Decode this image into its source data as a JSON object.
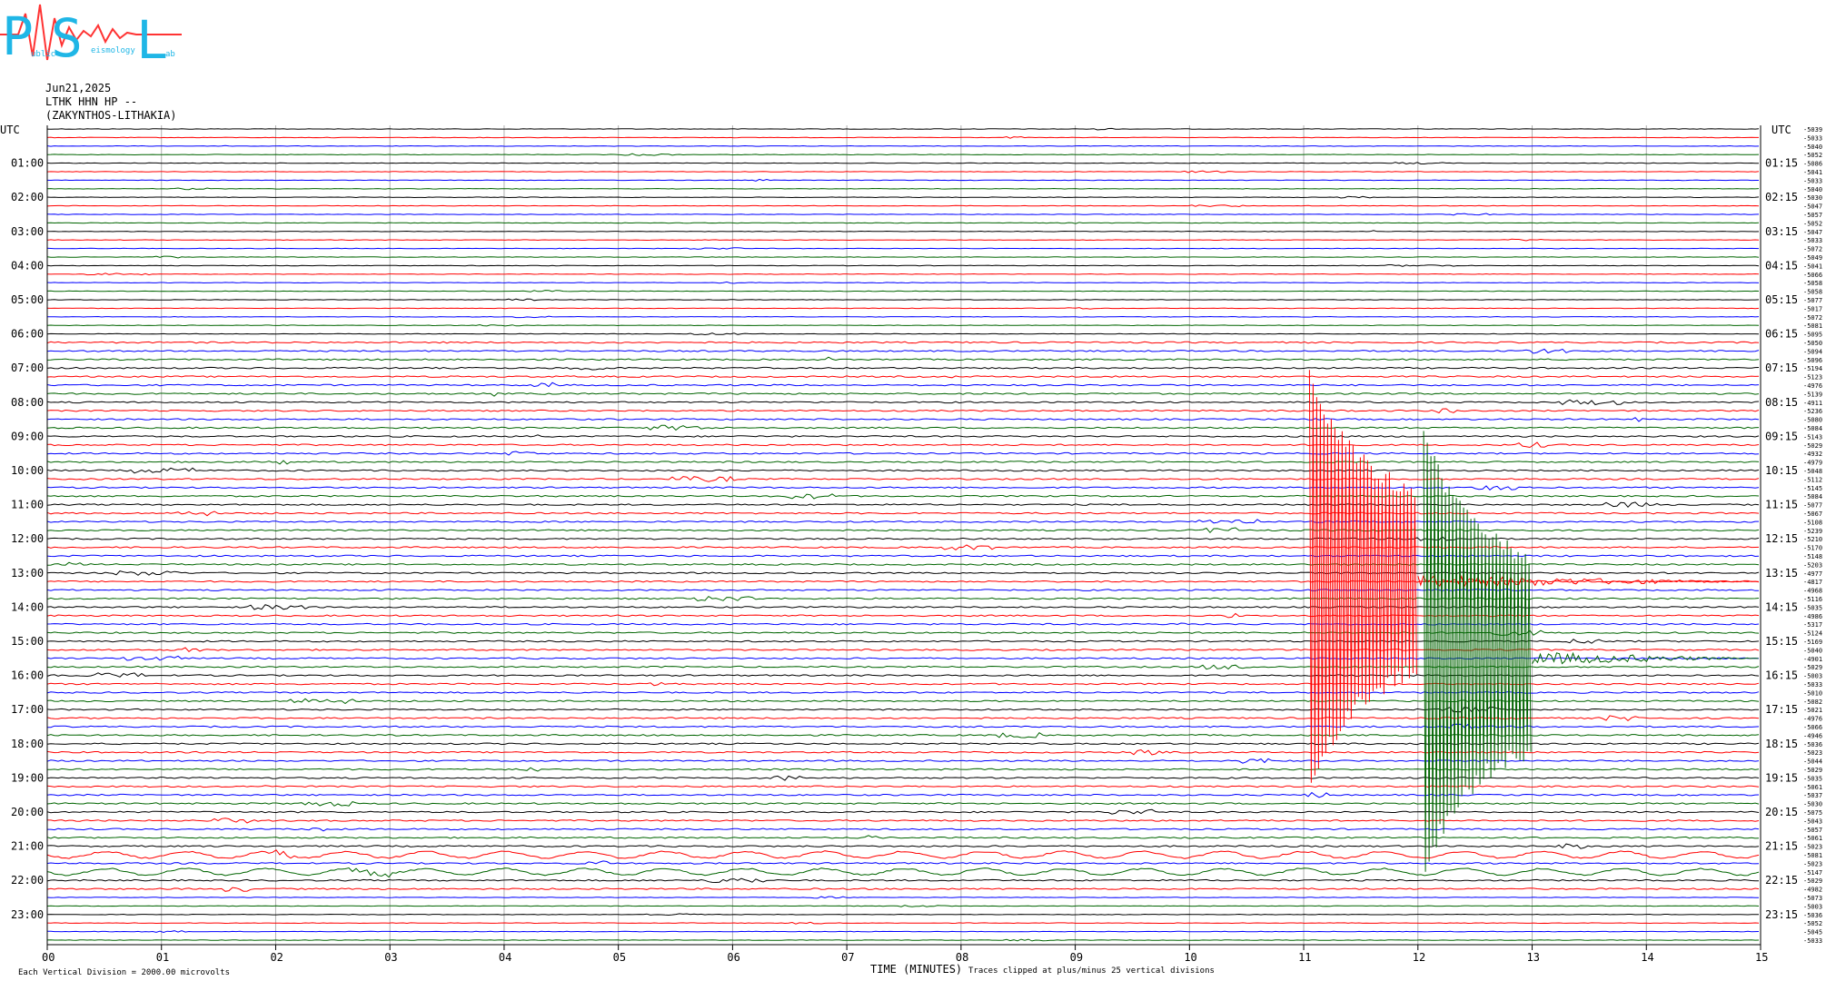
{
  "logo": {
    "letters": [
      "P",
      "S",
      "L"
    ],
    "small_words": [
      "ublic",
      "eismology",
      "ab"
    ]
  },
  "header": {
    "date": "Jun21,2025",
    "station": "LTHK HHN HP --",
    "location": "(ZAKYNTHOS-LITHAKIA)"
  },
  "footer": {
    "scale_note": "Each Vertical Division = 2000.00 microvolts",
    "axis_title": "TIME (MINUTES)",
    "clip_note": "Traces clipped at plus/minus 25 vertical divisions"
  },
  "chart_data": {
    "type": "line",
    "title": "",
    "xlabel": "TIME (MINUTES)",
    "xlim": [
      0,
      15
    ],
    "x_ticks": [
      "00",
      "01",
      "02",
      "03",
      "04",
      "05",
      "06",
      "07",
      "08",
      "09",
      "10",
      "11",
      "12",
      "13",
      "14",
      "15"
    ],
    "left_axis_top_label": "UTC",
    "right_axis_top_label": "UTC",
    "left_hour_labels": [
      "01:00",
      "02:00",
      "03:00",
      "04:00",
      "05:00",
      "06:00",
      "07:00",
      "08:00",
      "09:00",
      "10:00",
      "11:00",
      "12:00",
      "13:00",
      "14:00",
      "15:00",
      "16:00",
      "17:00",
      "18:00",
      "19:00",
      "20:00",
      "21:00",
      "22:00",
      "23:00"
    ],
    "right_hour_labels": [
      "01:15",
      "02:15",
      "03:15",
      "04:15",
      "05:15",
      "06:15",
      "07:15",
      "08:15",
      "09:15",
      "10:15",
      "11:15",
      "12:15",
      "13:15",
      "14:15",
      "15:15",
      "16:15",
      "17:15",
      "18:15",
      "19:15",
      "20:15",
      "21:15",
      "22:15",
      "23:15"
    ],
    "row_minutes": 15,
    "row_count": 96,
    "trace_colors": [
      "#000000",
      "#ff0000",
      "#0000ff",
      "#006400"
    ],
    "clip_divisions": 25,
    "microvolts_per_division": 2000,
    "row_offsets": [
      "-5039",
      "-5033",
      "-5040",
      "-5052",
      "-5086",
      "-5041",
      "-5033",
      "-5040",
      "-5030",
      "-5047",
      "-5057",
      "-5052",
      "-5047",
      "-5033",
      "-5072",
      "-5049",
      "-5041",
      "-5066",
      "-5058",
      "-5058",
      "-5077",
      "-5017",
      "-5072",
      "-5081",
      "-5095",
      "-5050",
      "-5094",
      "-5096",
      "-5194",
      "-5123",
      "-4976",
      "-5139",
      "-4911",
      "-5236",
      "-5080",
      "-5084",
      "-5143",
      "-5029",
      "-4932",
      "-4979",
      "-5048",
      "-5112",
      "-5145",
      "-5084",
      "-5077",
      "-5067",
      "-5108",
      "-5239",
      "-5210",
      "-5170",
      "-5148",
      "-5203",
      "-4977",
      "-4817",
      "-4968",
      "-5116",
      "-5035",
      "-4986",
      "-5317",
      "-5124",
      "-5169",
      "-5040",
      "-4901",
      "-5029",
      "-5003",
      "-5033",
      "-5010",
      "-5082",
      "-5021",
      "-4976",
      "-5066",
      "-4946",
      "-5036",
      "-5023",
      "-5044",
      "-5029",
      "-5035",
      "-5061",
      "-5037",
      "-5030",
      "-5075",
      "-5043",
      "-5057",
      "-5061",
      "-5023",
      "-5081",
      "-5023",
      "-5147",
      "-5029",
      "-4982",
      "-5073",
      "-5003",
      "-5036",
      "-5052",
      "-5045",
      "-5033"
    ],
    "events": [
      {
        "name": "large event",
        "row_start": 28,
        "row_end": 78,
        "minute_start": 11.05,
        "minute_end": 12.0,
        "color": "#ff0000"
      },
      {
        "name": "secondary arrival",
        "row_start": 35,
        "row_end": 88,
        "minute_start": 12.05,
        "minute_end": 13.0,
        "color": "#006400"
      }
    ]
  }
}
